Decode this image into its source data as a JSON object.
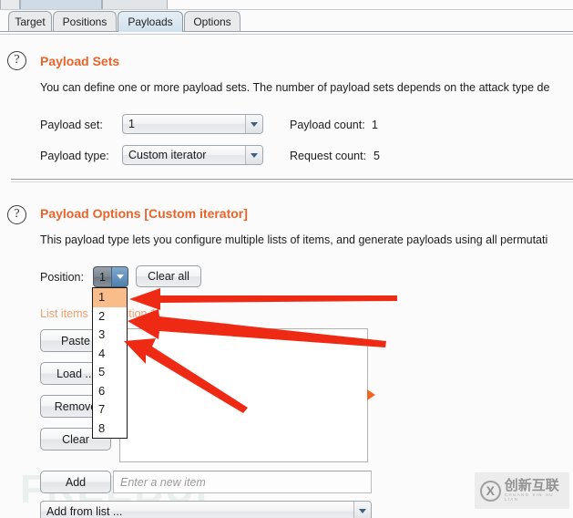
{
  "window": {
    "ghost_tabs": [
      "",
      "",
      ""
    ]
  },
  "tabs": [
    {
      "label": "Target",
      "active": false
    },
    {
      "label": "Positions",
      "active": false
    },
    {
      "label": "Payloads",
      "active": true
    },
    {
      "label": "Options",
      "active": false
    }
  ],
  "payload_sets": {
    "help_icon": "question-mark-icon",
    "title": "Payload Sets",
    "description": "You can define one or more payload sets. The number of payload sets depends on the attack type de",
    "payload_set_label": "Payload set:",
    "payload_set_value": "1",
    "payload_type_label": "Payload type:",
    "payload_type_value": "Custom iterator",
    "payload_count_label": "Payload count:",
    "payload_count_value": "1",
    "request_count_label": "Request count:",
    "request_count_value": "5"
  },
  "payload_options": {
    "help_icon": "question-mark-icon",
    "title": "Payload Options [Custom iterator]",
    "description": "This payload type lets you configure multiple lists of items, and generate payloads using all permutati",
    "position_label": "Position:",
    "position_value": "1",
    "clear_all_label": "Clear all",
    "position_options": [
      "1",
      "2",
      "3",
      "4",
      "5",
      "6",
      "7",
      "8"
    ],
    "position_selected_index": 0,
    "list_caption": "List items for position 1",
    "side_buttons": [
      "Paste",
      "Load ...",
      "Remove",
      "Clear"
    ],
    "list_items": [],
    "play_marker": "play-triangle-icon",
    "add_label": "Add",
    "add_input_placeholder": "Enter a new item",
    "add_input_value": "",
    "add_from_list_value": "Add from list ..."
  },
  "watermarks": {
    "background_text": "FREEBUF",
    "corner_mark": "X",
    "corner_text": "创新互联",
    "corner_subtext": "CHUANG XIN HU LIAN"
  },
  "annotations": {
    "arrow_color": "#ef2a14",
    "arrows": [
      {
        "name": "arrow-to-option-1",
        "target": "1"
      },
      {
        "name": "arrow-to-option-2",
        "target": "2"
      },
      {
        "name": "arrow-to-option-3",
        "target": "3"
      }
    ]
  },
  "colors": {
    "accent_orange": "#e8642a",
    "selected_item": "#f9bd8c",
    "background": "#fbfbfb",
    "arrow_red": "#ef2a14"
  }
}
